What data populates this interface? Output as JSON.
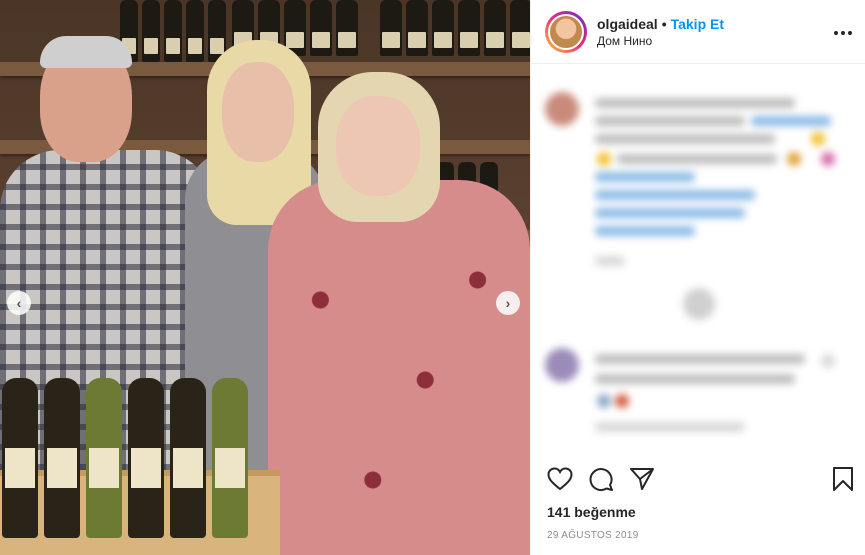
{
  "post": {
    "username": "olgaideal",
    "separator": "•",
    "follow_label": "Takip Et",
    "location": "Дом Нино",
    "more_icon": "more-options-icon",
    "likes_text": "141 beğenme",
    "date_text": "29 AĞUSTOS 2019"
  },
  "carousel": {
    "prev_glyph": "‹",
    "next_glyph": "›"
  },
  "actions": {
    "icons": [
      "heart-icon",
      "comment-icon",
      "share-icon",
      "bookmark-icon"
    ]
  },
  "colors": {
    "accent": "#0095f6",
    "text": "#262626",
    "muted": "#8e8e8e",
    "border": "#efefef"
  }
}
